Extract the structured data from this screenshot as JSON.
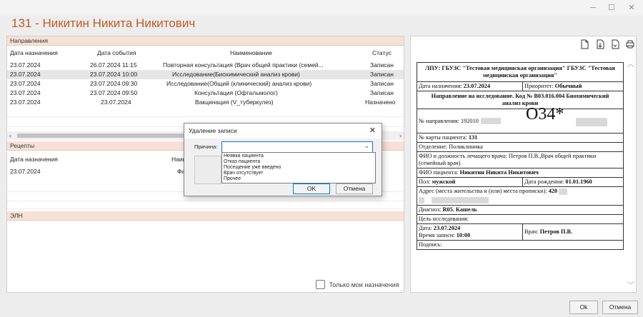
{
  "window": {
    "minimize": "─",
    "maximize": "☐",
    "close": "✕"
  },
  "patient_title": "131 - Никитин Никита Никитович",
  "directions": {
    "section_label": "Направления",
    "columns": [
      "Дата назначения",
      "Дата события",
      "Наименование",
      "Статус"
    ],
    "rows": [
      [
        "23.07.2024",
        "26.07.2024 11:15",
        "Повторная консультация (Врач общей практики (семей...",
        "Записан"
      ],
      [
        "23.07.2024",
        "23.07.2024 10:00",
        "Исследование(Биохимический анализ крови)",
        "Записан"
      ],
      [
        "23.07.2024",
        "23.07.2024 09:30",
        "Исследование(Общий (клинический) анализ крови)",
        "Записан"
      ],
      [
        "23.07.2024",
        "23.07.2024 09:50",
        "Консультация (Офтальмолог)",
        "Записан"
      ],
      [
        "23.07.2024",
        "23.07.2024",
        "Вакцинация (V_туберкулез)",
        "Назначено"
      ]
    ]
  },
  "recipes": {
    "section_label": "Рецепты",
    "columns": [
      "Дата назначения",
      "Наим"
    ],
    "rows": [
      [
        "23.07.2024",
        "Фа"
      ]
    ]
  },
  "eln": {
    "section_label": "ЭЛН"
  },
  "only_mine_label": "Только мои назначения",
  "document": {
    "lpu": "ЛПУ: ГБУЗС \"Тестовая медицинская организация\" ГБУЗС \"Тестовая медицинская организация\"",
    "date_label": "Дата назначения:",
    "date_value": "23.07.2024",
    "priority_label": "Приоритет:",
    "priority_value": "Обычный",
    "heading": "Направление на исследование. Код № B03.016.004 Биохимический анализ крови",
    "direction_no_label": "№ направления: 192010",
    "barcode_text": "O34*",
    "card_label": "№ карты пациента:",
    "card_value": "131",
    "department": "Отделение: Поликлиника",
    "doctor_line": "ФИО и должность лечащего врача: Петров П.В.,Врач общей практики (семейный врач)",
    "patient_label": "ФИО пациента:",
    "patient_value": "Никитин Никита Никитович",
    "sex_label": "Пол:",
    "sex_value": "мужской",
    "dob_label": "Дата рождения:",
    "dob_value": "01.01.1960",
    "address_label": "Адрес (места жительства и (или) места прописки):",
    "address_value": "420",
    "diagnosis_label": "Диагноз:",
    "diagnosis_value": "R05. Кашель",
    "purpose": "Цель исследования:",
    "visit_date_label": "Дата:",
    "visit_date_value": "23.07.2024",
    "visit_time_label": "Время записи:",
    "visit_time_value": "10:00",
    "doctor_label": "Врач:",
    "doctor_value": "Петров П.В.",
    "signature": "Подпись:"
  },
  "footer": {
    "ok": "Ok",
    "cancel": "Отмена"
  },
  "dialog": {
    "title": "Удаление записи",
    "reason_label": "Причина:",
    "reason_value": "",
    "options": [
      "Неявка пациента",
      "Отказ пациента",
      "Посещение уже введено",
      "Врач отсутствует",
      "Прочее"
    ],
    "ok": "OK",
    "cancel": "Отмена"
  }
}
